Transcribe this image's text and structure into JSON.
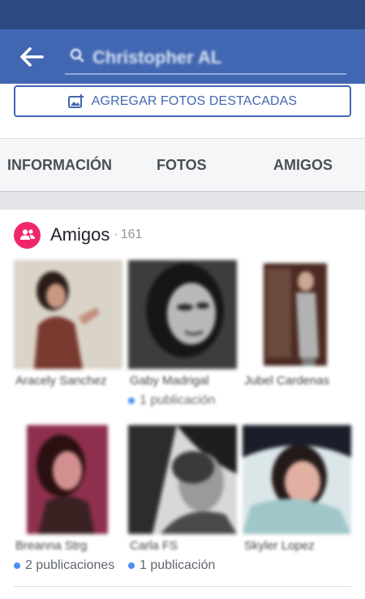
{
  "app_bar": {
    "search_value": "Christopher AL"
  },
  "featured": {
    "button_label": "AGREGAR FOTOS DESTACADAS"
  },
  "tabs": [
    {
      "label": "INFORMACIÓN"
    },
    {
      "label": "FOTOS"
    },
    {
      "label": "AMIGOS"
    }
  ],
  "friends": {
    "title": "Amigos",
    "separator": "·",
    "count": "161",
    "items": [
      {
        "name": "Aracely Sanchez",
        "posts": ""
      },
      {
        "name": "Gaby Madrigal",
        "posts": "1 publicación"
      },
      {
        "name": "Jubel Cardenas",
        "posts": ""
      },
      {
        "name": "Breanna Strg",
        "posts": "2 publicaciones"
      },
      {
        "name": "Carla FS",
        "posts": "1 publicación"
      },
      {
        "name": "Skyler Lopez",
        "posts": ""
      }
    ]
  },
  "colors": {
    "status_bar": "#2f4a83",
    "app_bar": "#4267b2",
    "accent_pink": "#f02869",
    "post_dot": "#4a8ff2"
  }
}
